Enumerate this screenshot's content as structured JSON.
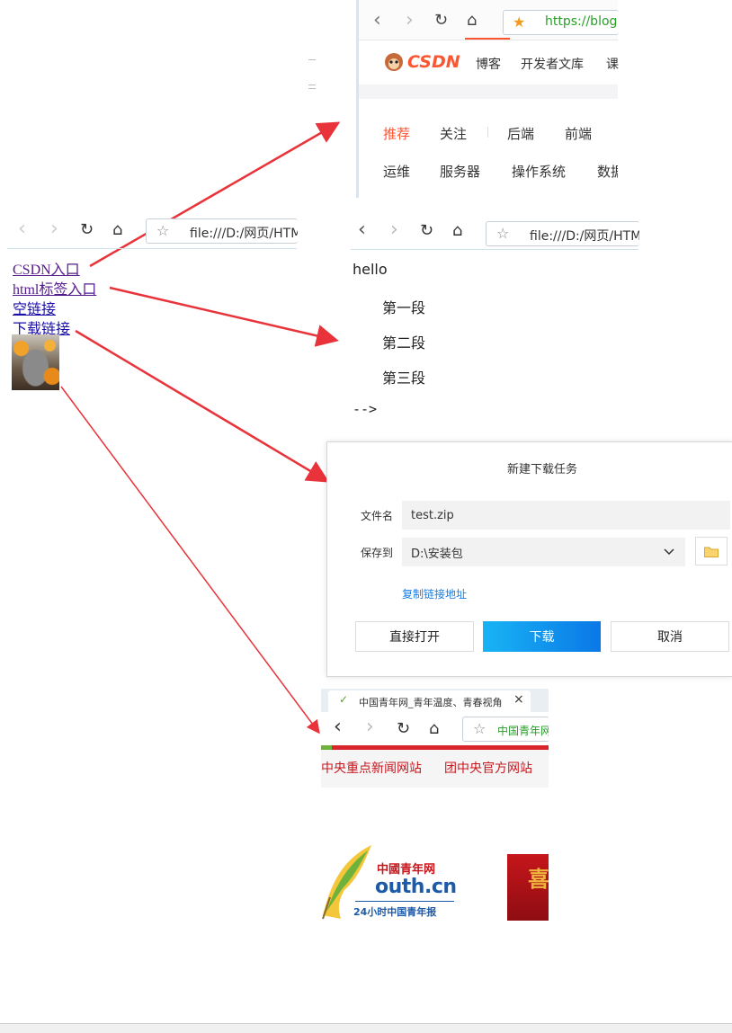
{
  "csdn_browser": {
    "url": "https://blog",
    "brand": "CSDN",
    "top_nav": [
      "博客",
      "开发者文库",
      "课"
    ],
    "tabs_row1": [
      "推荐",
      "关注",
      "后端",
      "前端"
    ],
    "tabs_row2": [
      "运维",
      "服务器",
      "操作系统",
      "数据"
    ]
  },
  "main_browser": {
    "url": "file:///D:/网页/HTML",
    "links": [
      "CSDN入口",
      "html标签入口",
      "空链接",
      "下载链接"
    ]
  },
  "html_browser": {
    "url": "file:///D:/网页/HTML",
    "hello": "hello",
    "paragraphs": [
      "第一段",
      "第二段",
      "第三段"
    ],
    "comment_end": "-->"
  },
  "download_dialog": {
    "title": "新建下载任务",
    "filename_label": "文件名",
    "filename_value": "test.zip",
    "saveto_label": "保存到",
    "saveto_value": "D:\\安装包",
    "copy_link": "复制链接地址",
    "open_label": "直接打开",
    "download_label": "下载",
    "cancel_label": "取消"
  },
  "youth_browser": {
    "tab_title": "中国青年网_青年温度、青春视角",
    "url": "中国青年网",
    "nav": [
      "中央重点新闻网站",
      "团中央官方网站"
    ],
    "logo_top": "中國青年网",
    "logo_main": "outh.cn",
    "logo_slogan": "24小时中国青年报",
    "banner_char": "喜"
  },
  "colors": {
    "arrow": "#e8333a",
    "csdn_red": "#fc5531",
    "link_blue": "#1a0dab",
    "link_visited": "#551a8b",
    "download_blue": "#0a78e6"
  }
}
